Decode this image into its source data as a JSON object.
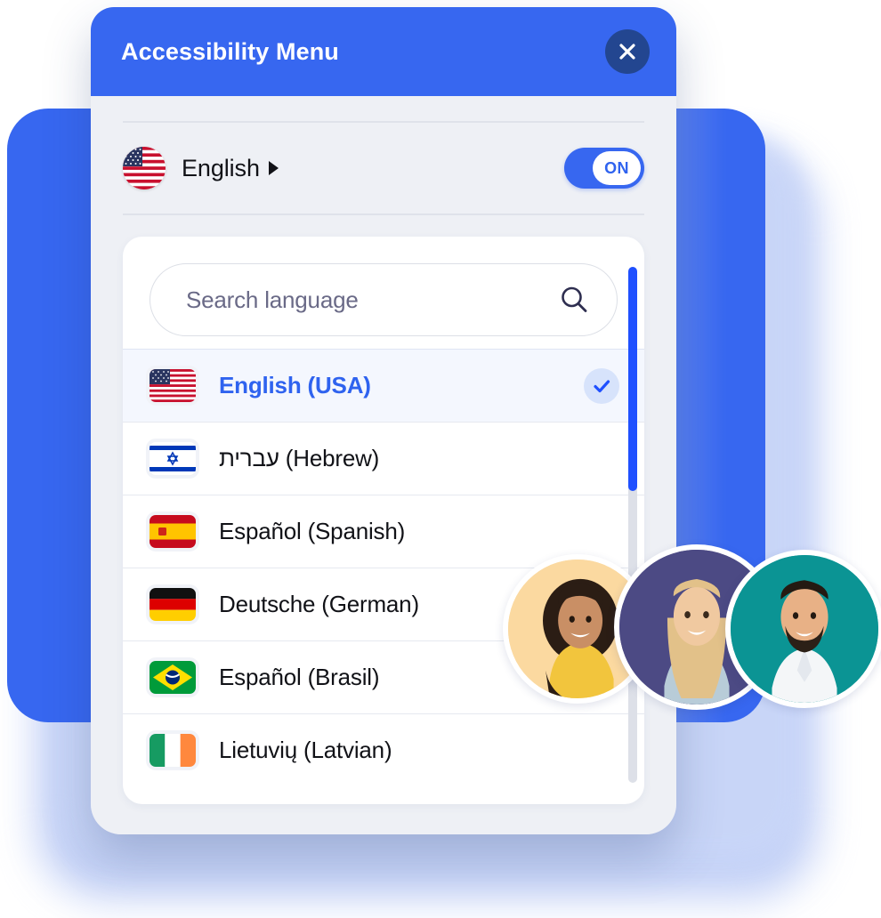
{
  "window": {
    "title": "Accessibility Menu",
    "close_icon": "close-icon",
    "accent_blue": "#3767f0",
    "close_button_bg": "#234690",
    "panel_bg": "#eef0f5"
  },
  "language_row": {
    "flag": "flag-usa-circle",
    "label": "English",
    "caret_icon": "caret-right-icon",
    "toggle": {
      "state_label": "ON",
      "enabled": true,
      "color": "#3767f0"
    }
  },
  "search": {
    "placeholder": "Search language",
    "value": "",
    "icon": "search-icon"
  },
  "scrollbar": {
    "track_color": "#dde0e8",
    "thumb_color": "#1f50ff",
    "thumb_position_percent": 0
  },
  "languages": [
    {
      "label": "English (USA)",
      "flag": "flag-usa",
      "selected": true,
      "check_icon": "check-icon"
    },
    {
      "label": "עברית (Hebrew)",
      "flag": "flag-israel",
      "selected": false
    },
    {
      "label": "Español (Spanish)",
      "flag": "flag-spain",
      "selected": false
    },
    {
      "label": "Deutsche (German)",
      "flag": "flag-germany",
      "selected": false
    },
    {
      "label": "Español (Brasil)",
      "flag": "flag-brazil",
      "selected": false
    },
    {
      "label": "Lietuvių (Latvian)",
      "flag": "flag-ireland",
      "selected": false
    }
  ],
  "avatars": [
    {
      "name": "avatar-woman-curly-hair",
      "bg": "#fbd9a0"
    },
    {
      "name": "avatar-woman-blonde",
      "bg": "#4c4a84"
    },
    {
      "name": "avatar-man-beard",
      "bg": "#0b9494"
    }
  ]
}
